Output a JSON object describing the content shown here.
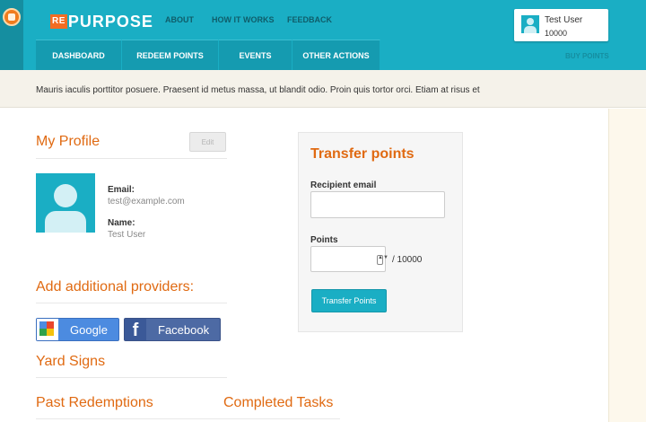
{
  "brand": {
    "badge": "RE",
    "name": "PURPOSE"
  },
  "topnav": [
    "ABOUT",
    "HOW IT WORKS",
    "FEEDBACK"
  ],
  "tabs": [
    "DASHBOARD",
    "REDEEM POINTS",
    "EVENTS",
    "OTHER ACTIONS"
  ],
  "buy_points": "BUY POINTS",
  "user": {
    "name": "Test User",
    "points": "10000"
  },
  "banner_text": "Mauris iaculis porttitor posuere. Praesent id metus massa, ut blandit odio. Proin quis tortor orci. Etiam at risus et",
  "profile": {
    "title": "My Profile",
    "edit_label": "Edit",
    "email_label": "Email:",
    "email_value": "test@example.com",
    "name_label": "Name:",
    "name_value": "Test User"
  },
  "providers": {
    "title": "Add additional providers:",
    "google_label": "Google",
    "facebook_label": "Facebook",
    "facebook_glyph": "f"
  },
  "sections": {
    "yard_signs": "Yard Signs",
    "past_redemptions": "Past Redemptions",
    "completed_tasks": "Completed Tasks"
  },
  "transfer": {
    "title": "Transfer points",
    "recipient_label": "Recipient email",
    "recipient_value": "",
    "points_label": "Points",
    "points_value": "",
    "points_max": "/ 10000",
    "button_label": "Transfer Points",
    "spinner_glyph": "▲▼"
  },
  "colors": {
    "accent": "#1aaec4",
    "heading": "#e06a12",
    "brand_badge": "#f26c22"
  }
}
